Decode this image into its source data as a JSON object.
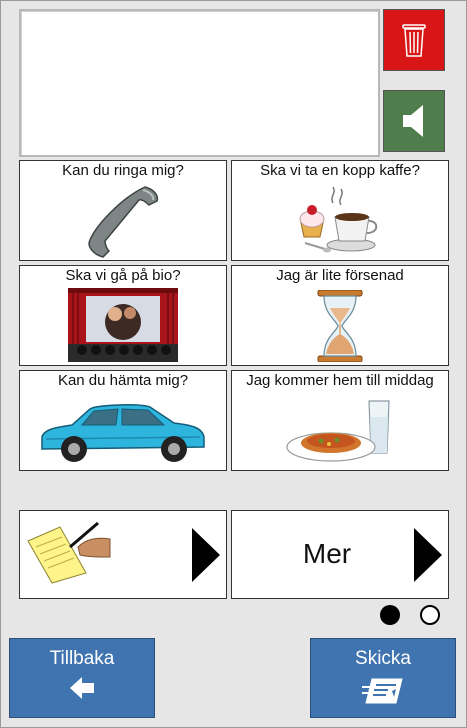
{
  "tiles": [
    {
      "label": "Kan du ringa mig?",
      "icon": "phone-receiver-icon"
    },
    {
      "label": "Ska vi ta en kopp kaffe?",
      "icon": "coffee-cup-cake-icon"
    },
    {
      "label": "Ska vi gå på bio?",
      "icon": "cinema-icon"
    },
    {
      "label": "Jag är lite försenad",
      "icon": "hourglass-icon"
    },
    {
      "label": "Kan du hämta mig?",
      "icon": "car-icon"
    },
    {
      "label": "Jag kommer hem till middag",
      "icon": "dinner-icon"
    }
  ],
  "bottom_tiles": {
    "notepad_icon": "writing-notepad-icon",
    "more_label": "Mer"
  },
  "toolbar": {
    "delete_icon": "trash-can-icon",
    "speak_icon": "speaker-icon"
  },
  "pager": {
    "current_page": 1,
    "total_pages": 2
  },
  "nav": {
    "back_label": "Tillbaka",
    "back_icon": "arrow-left-icon",
    "send_label": "Skicka",
    "send_icon": "send-letter-icon"
  },
  "colors": {
    "delete": "#d91616",
    "speak": "#4f7d4b",
    "nav": "#3f74b0"
  }
}
